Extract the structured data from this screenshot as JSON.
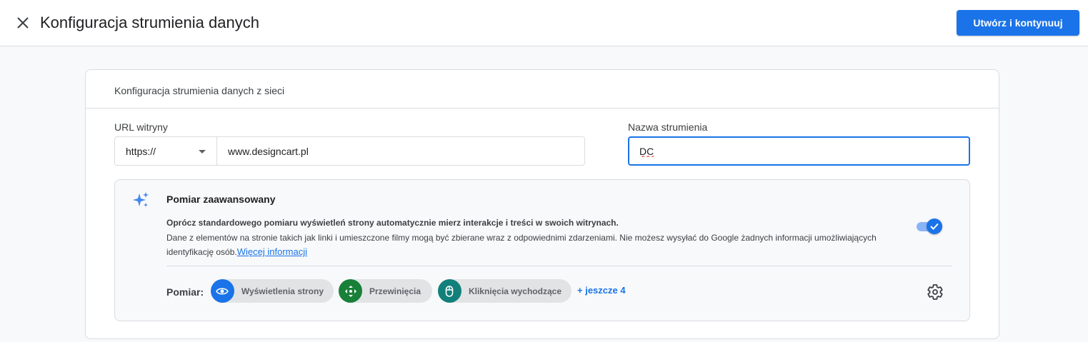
{
  "header": {
    "title": "Konfiguracja strumienia danych",
    "primary_button": "Utwórz i kontynuuj"
  },
  "card": {
    "title": "Konfiguracja strumienia danych z sieci",
    "url_label": "URL witryny",
    "protocol_value": "https://",
    "url_value": "www.designcart.pl",
    "name_label": "Nazwa strumienia",
    "name_value": "DC"
  },
  "enhanced": {
    "title": "Pomiar zaawansowany",
    "bold_text": "Oprócz standardowego pomiaru wyświetleń strony automatycznie mierz interakcje i treści w swoich witrynach.",
    "desc_text": "Dane z elementów na stronie takich jak linki i umieszczone filmy mogą być zbierane wraz z odpowiednimi zdarzeniami. Nie możesz wysyłać do Google żadnych informacji umożliwiających identyfikację osób.",
    "link_text": "Więcej informacji",
    "toggle_on": true,
    "metrics_label": "Pomiar:",
    "chips": [
      {
        "label": "Wyświetlenia strony",
        "icon": "eye-icon",
        "color": "#1a73e8"
      },
      {
        "label": "Przewinięcia",
        "icon": "scroll-icon",
        "color": "#188038"
      },
      {
        "label": "Kliknięcia wychodzące",
        "icon": "mouse-icon",
        "color": "#12807a"
      }
    ],
    "more_link": "+ jeszcze 4"
  },
  "colors": {
    "accent": "#1a73e8",
    "border": "#dadce0",
    "background": "#f8f9fa"
  }
}
